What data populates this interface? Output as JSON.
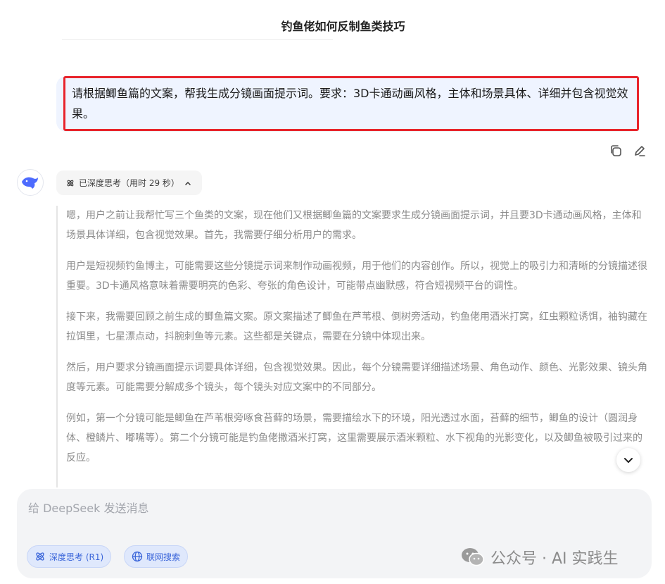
{
  "header": {
    "title": "钓鱼佬如何反制鱼类技巧"
  },
  "user_message": {
    "text": "请根据鲫鱼篇的文案，帮我生成分镜画面提示词。要求：3D卡通动画风格，主体和场景具体、详细并包含视觉效果。"
  },
  "message_actions": {
    "copy_icon": "copy-icon",
    "edit_icon": "edit-icon"
  },
  "assistant": {
    "avatar_icon": "deepseek-whale-icon",
    "think_label": "已深度思考（用时 29 秒）",
    "think_paragraphs": [
      "嗯，用户之前让我帮忙写三个鱼类的文案，现在他们又根据鲫鱼篇的文案要求生成分镜画面提示词，并且要3D卡通动画风格，主体和场景具体详细，包含视觉效果。首先，我需要仔细分析用户的需求。",
      "用户是短视频钓鱼博主，可能需要这些分镜提示词来制作动画视频，用于他们的内容创作。所以，视觉上的吸引力和清晰的分镜描述很重要。3D卡通风格意味着需要明亮的色彩、夸张的角色设计，可能带点幽默感，符合短视频平台的调性。",
      "接下来，我需要回顾之前生成的鲫鱼篇文案。原文案描述了鲫鱼在芦苇根、倒树旁活动，钓鱼佬用酒米打窝，红虫颗粒诱饵，袖钩藏在拉饵里，七星漂点动，抖腕刺鱼等元素。这些都是关键点，需要在分镜中体现出来。",
      "然后，用户要求分镜画面提示词要具体详细，包含视觉效果。因此，每个分镜需要详细描述场景、角色动作、颜色、光影效果、镜头角度等元素。可能需要分解成多个镜头，每个镜头对应文案中的不同部分。",
      "例如，第一个分镜可能是鲫鱼在芦苇根旁啄食苔藓的场景，需要描绘水下的环境，阳光透过水面，苔藓的细节，鲫鱼的设计（圆润身体、橙鳞片、嘟嘴等）。第二个分镜可能是钓鱼佬撒酒米打窝，这里需要展示酒米颗粒、水下视角的光影变化，以及鲫鱼被吸引过来的反应。"
    ]
  },
  "composer": {
    "placeholder": "给 DeepSeek 发送消息",
    "deep_think_label": "深度思考 (R1)",
    "web_search_label": "联网搜索"
  },
  "watermark": {
    "text": "公众号 · AI 实践生"
  },
  "colors": {
    "accent": "#3964d9",
    "highlight_border": "#e8242c",
    "user_bubble": "#eff4ff"
  }
}
